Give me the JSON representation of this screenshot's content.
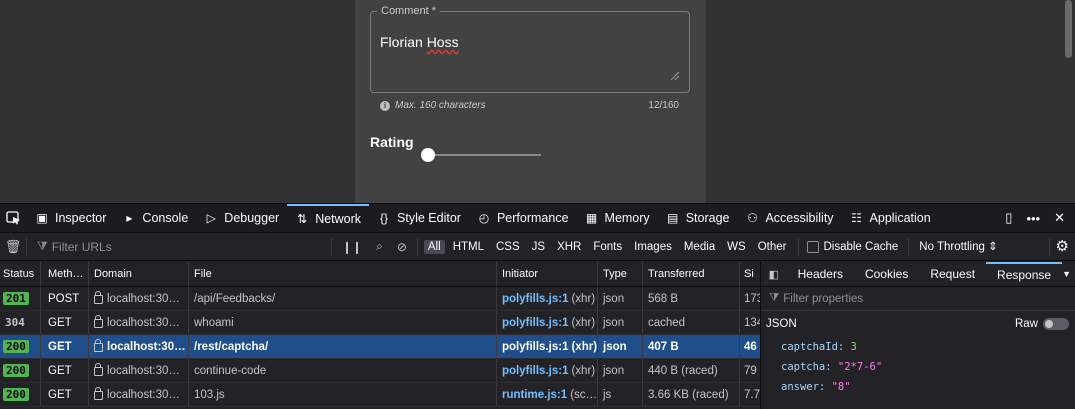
{
  "page": {
    "comment_label": "Comment *",
    "comment_first": "Florian",
    "comment_second": "Hoss",
    "hint": "Max. 160 characters",
    "counter": "12/160",
    "rating_label": "Rating",
    "rating_value": 0
  },
  "devtools": {
    "tabs": [
      {
        "label": "Inspector",
        "icon": "inspector-icon"
      },
      {
        "label": "Console",
        "icon": "console-icon"
      },
      {
        "label": "Debugger",
        "icon": "debugger-icon"
      },
      {
        "label": "Network",
        "icon": "network-icon",
        "active": true
      },
      {
        "label": "Style Editor",
        "icon": "style-editor-icon"
      },
      {
        "label": "Performance",
        "icon": "performance-icon"
      },
      {
        "label": "Memory",
        "icon": "memory-icon"
      },
      {
        "label": "Storage",
        "icon": "storage-icon"
      },
      {
        "label": "Accessibility",
        "icon": "accessibility-icon"
      },
      {
        "label": "Application",
        "icon": "application-icon"
      }
    ],
    "toolbar": {
      "filter_placeholder": "Filter URLs",
      "types": [
        "All",
        "HTML",
        "CSS",
        "JS",
        "XHR",
        "Fonts",
        "Images",
        "Media",
        "WS",
        "Other"
      ],
      "active_type": "All",
      "disable_cache": "Disable Cache",
      "throttling": "No Throttling ⇕"
    },
    "columns": [
      "Status",
      "Meth…",
      "Domain",
      "File",
      "Initiator",
      "Type",
      "Transferred",
      "Si"
    ],
    "requests": [
      {
        "status": "201",
        "method": "POST",
        "domain": "localhost:30…",
        "file": "/api/Feedbacks/",
        "initiator": "polyfills.js:1",
        "initiator_extra": "(xhr)",
        "type": "json",
        "transferred": "568 B",
        "size": "173"
      },
      {
        "status": "304",
        "method": "GET",
        "domain": "localhost:30…",
        "file": "whoami",
        "initiator": "polyfills.js:1",
        "initiator_extra": "(xhr)",
        "type": "json",
        "transferred": "cached",
        "size": "134"
      },
      {
        "status": "200",
        "method": "GET",
        "domain": "localhost:30…",
        "file": "/rest/captcha/",
        "initiator": "polyfills.js:1",
        "initiator_extra": "(xhr)",
        "type": "json",
        "transferred": "407 B",
        "size": "46",
        "selected": true
      },
      {
        "status": "200",
        "method": "GET",
        "domain": "localhost:30…",
        "file": "continue-code",
        "initiator": "polyfills.js:1",
        "initiator_extra": "(xhr)",
        "type": "json",
        "transferred": "440 B (raced)",
        "size": "79"
      },
      {
        "status": "200",
        "method": "GET",
        "domain": "localhost:30…",
        "file": "103.js",
        "initiator": "runtime.js:1",
        "initiator_extra": "(sc…",
        "type": "js",
        "transferred": "3.66 KB (raced)",
        "size": "7.7"
      }
    ],
    "side": {
      "tabs": [
        "Headers",
        "Cookies",
        "Request",
        "Response"
      ],
      "active_tab": "Response",
      "filter_placeholder": "Filter properties",
      "json_label": "JSON",
      "raw_label": "Raw",
      "json": [
        {
          "key": "captchaId:",
          "value": "3",
          "kind": "num"
        },
        {
          "key": "captcha:",
          "value": "\"2*7-6\"",
          "kind": "str"
        },
        {
          "key": "answer:",
          "value": "\"8\"",
          "kind": "str"
        }
      ]
    }
  }
}
